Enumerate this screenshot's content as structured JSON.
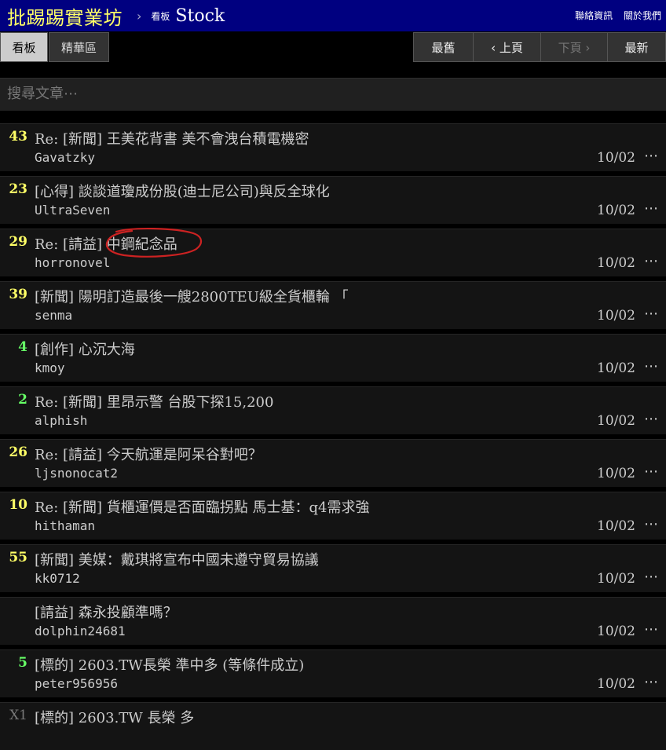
{
  "header": {
    "site_title": "批踢踢實業坊",
    "separator": "›",
    "board_label": "看板",
    "board_name": "Stock",
    "links": [
      "聯絡資訊",
      "關於我們"
    ]
  },
  "actions": {
    "tab_board": "看板",
    "tab_digest": "精華區",
    "btn_oldest": "最舊",
    "btn_prev": "‹ 上頁",
    "btn_next": "下頁 ›",
    "btn_latest": "最新"
  },
  "search": {
    "placeholder": "搜尋文章⋯"
  },
  "colors": {
    "topbar_bg": "#000080",
    "site_title": "#ffff66",
    "count_yellow": "#ffff66",
    "count_green": "#66ff66",
    "count_gray": "#777777",
    "annotation_red": "#cc2222"
  },
  "posts": [
    {
      "count": "43",
      "count_color": "yellow",
      "title": "Re: [新聞] 王美花背書 美不會洩台積電機密",
      "author": "Gavatzky",
      "date": "10/02",
      "more": "⋯"
    },
    {
      "count": "23",
      "count_color": "yellow",
      "title": "[心得] 談談道瓊成份股(迪士尼公司)與反全球化",
      "author": "UltraSeven",
      "date": "10/02",
      "more": "⋯"
    },
    {
      "count": "29",
      "count_color": "yellow",
      "title": "Re: [請益] 中鋼紀念品",
      "author": "horronovel",
      "date": "10/02",
      "more": "⋯"
    },
    {
      "count": "39",
      "count_color": "yellow",
      "title": "[新聞] 陽明訂造最後一艘2800TEU級全貨櫃輪 「",
      "author": "senma",
      "date": "10/02",
      "more": "⋯"
    },
    {
      "count": "4",
      "count_color": "green",
      "title": "[創作] 心沉大海",
      "author": "kmoy",
      "date": "10/02",
      "more": "⋯"
    },
    {
      "count": "2",
      "count_color": "green",
      "title": "Re: [新聞] 里昂示警 台股下探15,200",
      "author": "alphish",
      "date": "10/02",
      "more": "⋯"
    },
    {
      "count": "26",
      "count_color": "yellow",
      "title": "Re: [請益] 今天航運是阿呆谷對吧？",
      "author": "ljsnonocat2",
      "date": "10/02",
      "more": "⋯"
    },
    {
      "count": "10",
      "count_color": "yellow",
      "title": "Re: [新聞] 貨櫃運價是否面臨拐點 馬士基：q4需求強",
      "author": "hithaman",
      "date": "10/02",
      "more": "⋯"
    },
    {
      "count": "55",
      "count_color": "yellow",
      "title": "[新聞] 美媒：戴琪將宣布中國未遵守貿易協議",
      "author": "kk0712",
      "date": "10/02",
      "more": "⋯"
    },
    {
      "count": "",
      "count_color": "yellow",
      "title": "[請益] 森永投顧準嗎？",
      "author": "dolphin24681",
      "date": "10/02",
      "more": "⋯"
    },
    {
      "count": "5",
      "count_color": "green",
      "title": "[標的] 2603.TW長榮 準中多 (等條件成立)",
      "author": "peter956956",
      "date": "10/02",
      "more": "⋯"
    },
    {
      "count": "X1",
      "count_color": "gray",
      "title": "[標的] 2603.TW 長榮 多",
      "author": "",
      "date": "",
      "more": ""
    }
  ]
}
